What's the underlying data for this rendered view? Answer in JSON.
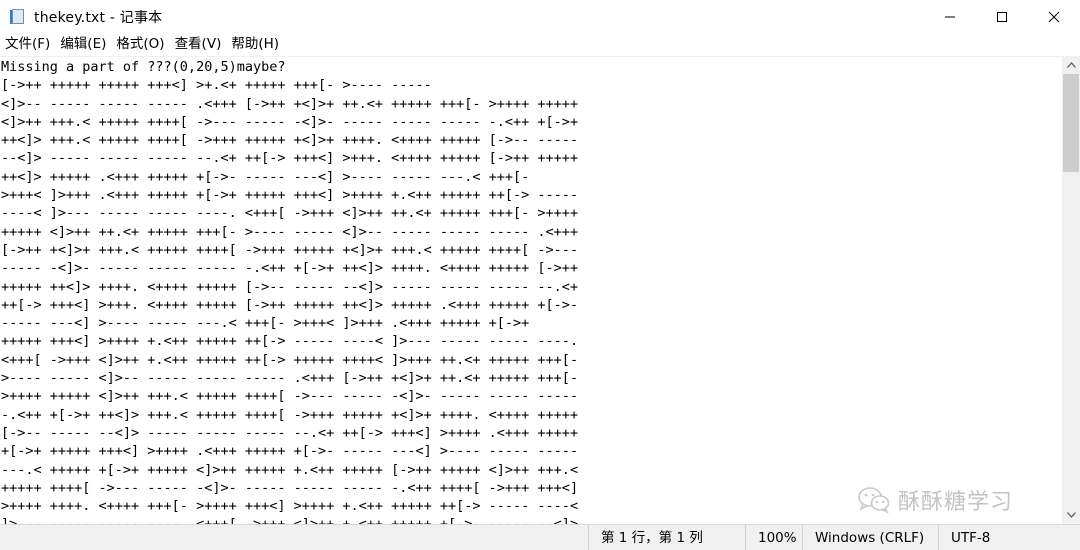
{
  "window": {
    "title": "thekey.txt - 记事本"
  },
  "menu": {
    "items": [
      "文件(F)",
      "编辑(E)",
      "格式(O)",
      "查看(V)",
      "帮助(H)"
    ]
  },
  "editor": {
    "lines": [
      "Missing a part of ???(0,20,5)maybe?",
      "[->++ +++++ +++++ +++<] >+.<+ +++++ +++[- >---- -----",
      "<]>-- ----- ----- ----- .<+++ [->++ +<]>+ ++.<+ +++++ +++[- >++++ +++++",
      "<]>++ +++.< +++++ ++++[ ->--- ----- -<]>- ----- ----- ----- -.<++ +[->+",
      "++<]> +++.< +++++ ++++[ ->+++ +++++ +<]>+ ++++. <++++ +++++ [->-- -----",
      "--<]> ----- ----- ----- --.<+ ++[-> +++<] >+++. <++++ +++++ [->++ +++++",
      "++<]> +++++ .<+++ +++++ +[->- ----- ---<] >---- ----- ---.< +++[-",
      ">+++< ]>+++ .<+++ +++++ +[->+ +++++ +++<] >++++ +.<++ +++++ ++[-> -----",
      "----< ]>--- ----- ----- ----. <+++[ ->+++ <]>++ ++.<+ +++++ +++[- >++++",
      "+++++ <]>++ ++.<+ +++++ +++[- >---- ----- <]>-- ----- ----- ----- .<+++",
      "[->++ +<]>+ +++.< +++++ ++++[ ->+++ +++++ +<]>+ +++.< +++++ ++++[ ->---",
      "----- -<]>- ----- ----- ----- -.<++ +[->+ ++<]> ++++. <++++ +++++ [->++",
      "+++++ ++<]> ++++. <++++ +++++ [->-- ----- --<]> ----- ----- ----- --.<+",
      "++[-> +++<] >+++. <++++ +++++ [->++ +++++ ++<]> +++++ .<+++ +++++ +[->-",
      "----- ---<] >---- ----- ---.< +++[- >+++< ]>+++ .<+++ +++++ +[->+",
      "+++++ +++<] >++++ +.<++ +++++ ++[-> ----- ----< ]>--- ----- ----- ----.",
      "<+++[ ->+++ <]>++ +.<++ +++++ ++[-> +++++ ++++< ]>+++ ++.<+ +++++ +++[-",
      ">---- ----- <]>-- ----- ----- ----- .<+++ [->++ +<]>+ ++.<+ +++++ +++[-",
      ">++++ +++++ <]>++ +++.< +++++ ++++[ ->--- ----- -<]>- ----- ----- -----",
      "-.<++ +[->+ ++<]> +++.< +++++ ++++[ ->+++ +++++ +<]>+ ++++. <++++ +++++",
      "[->-- ----- --<]> ----- ----- ----- --.<+ ++[-> +++<] >++++ .<+++ +++++",
      "+[->+ +++++ +++<] >++++ .<+++ +++++ +[->- ----- ---<] >---- ----- -----",
      "---.< +++++ +[->+ +++++ <]>++ +++++ +.<++ +++++ [->++ +++++ <]>++ +++.<",
      "+++++ ++++[ ->--- ----- -<]>- ----- ----- ----- -.<++ ++++[ ->+++ +++<]",
      ">++++ ++++. <++++ +++[- >++++ +++<] >++++ +.<++ +++++ ++[-> ----- ----<",
      "]>--- ----- ----- ----. <+++[ ->+++ <]>++ +.<++ +++++ +[->- ----- --<]>"
    ]
  },
  "status": {
    "position": "第 1 行，第 1 列",
    "zoom": "100%",
    "line_ending": "Windows (CRLF)",
    "encoding": "UTF-8"
  },
  "watermark": {
    "text": "酥酥糖学习",
    "icon": "wechat-icon"
  },
  "icons": {
    "app": "notepad-icon",
    "minimize": "minimize-icon",
    "maximize": "maximize-icon",
    "close": "close-icon",
    "scroll_up": "scroll-up-arrow-icon",
    "scroll_down": "scroll-down-arrow-icon"
  }
}
